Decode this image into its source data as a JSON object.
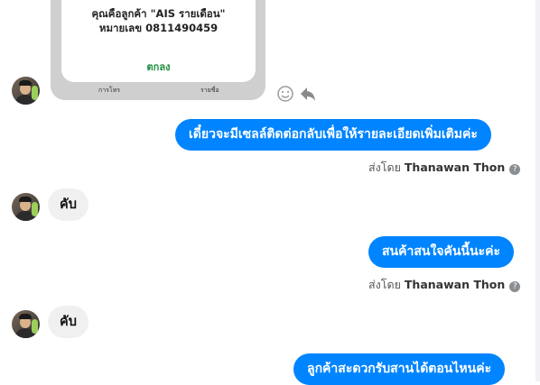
{
  "phone_card": {
    "line1": "คุณคือลูกค้า \"AIS รายเดือน\"",
    "line2": "หมายเลข 0811490459",
    "ok_label": "ตกลง",
    "tab_left": "การโทร",
    "tab_right": "รายชื่อ"
  },
  "messages": [
    {
      "direction": "out",
      "text": "เดี๋ยวจะมีเซลล์ติดต่อกลับเพื่อให้รายละเอียดเพิ่มเติมค่ะ"
    },
    {
      "direction": "meta",
      "prefix": "ส่งโดย",
      "sender": "Thanawan Thon",
      "help_icon": "?"
    },
    {
      "direction": "in",
      "text": "คับ"
    },
    {
      "direction": "out",
      "text": "สนค้าสนใจคันนี้นะค่ะ"
    },
    {
      "direction": "meta",
      "prefix": "ส่งโดย",
      "sender": "Thanawan Thon",
      "help_icon": "?"
    },
    {
      "direction": "in",
      "text": "คับ"
    },
    {
      "direction": "out",
      "text": "ลูกค้าสะดวกรับสานได้ตอนไหนค่ะ"
    }
  ],
  "icons": {
    "react": "smiley-react-icon",
    "reply": "reply-arrow-icon",
    "help": "help-circle-icon"
  },
  "colors": {
    "outgoing_bubble": "#0084ff",
    "incoming_bubble": "#f1f0f0",
    "ok_text": "#1e8e3e"
  }
}
